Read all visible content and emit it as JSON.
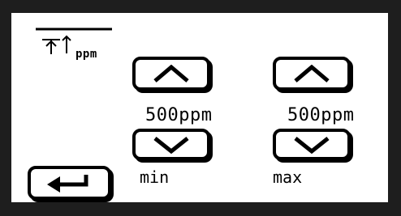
{
  "screen": {
    "unit_label": "ppm"
  },
  "min": {
    "value": "500ppm",
    "label": "min"
  },
  "max": {
    "value": "500ppm",
    "label": "max"
  },
  "icons": {
    "title": "upper-limit-icon",
    "up": "chevron-up-icon",
    "down": "chevron-down-icon",
    "enter": "return-arrow-icon"
  },
  "colors": {
    "bezel": "#1e1e1e",
    "screen": "#ffffff",
    "ink": "#000000"
  }
}
